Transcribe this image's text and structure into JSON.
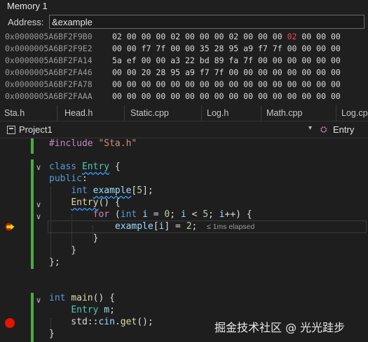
{
  "memory": {
    "title": "Memory 1",
    "address_label": "Address:",
    "address_value": "&example",
    "rows": [
      {
        "addr": "0x0000005A6BF2F9B0",
        "bytes": [
          "02",
          "00",
          "00",
          "00",
          "02",
          "00",
          "00",
          "00",
          "02",
          "00",
          "00",
          "00",
          "02",
          "00",
          "00",
          "00"
        ],
        "changed": [
          12
        ]
      },
      {
        "addr": "0x0000005A6BF2F9E2",
        "bytes": [
          "00",
          "00",
          "f7",
          "7f",
          "00",
          "00",
          "35",
          "28",
          "95",
          "a9",
          "f7",
          "7f",
          "00",
          "00",
          "00",
          "00"
        ],
        "changed": []
      },
      {
        "addr": "0x0000005A6BF2FA14",
        "bytes": [
          "5a",
          "ef",
          "00",
          "00",
          "a3",
          "22",
          "bd",
          "89",
          "fa",
          "7f",
          "00",
          "00",
          "00",
          "00",
          "00",
          "00"
        ],
        "changed": []
      },
      {
        "addr": "0x0000005A6BF2FA46",
        "bytes": [
          "00",
          "00",
          "20",
          "28",
          "95",
          "a9",
          "f7",
          "7f",
          "00",
          "00",
          "00",
          "00",
          "00",
          "00",
          "00",
          "00"
        ],
        "changed": []
      },
      {
        "addr": "0x0000005A6BF2FA78",
        "bytes": [
          "00",
          "00",
          "00",
          "00",
          "00",
          "00",
          "00",
          "00",
          "00",
          "00",
          "00",
          "00",
          "00",
          "00",
          "00",
          "00"
        ],
        "changed": []
      },
      {
        "addr": "0x0000005A6BF2FAAA",
        "bytes": [
          "00",
          "00",
          "00",
          "00",
          "00",
          "00",
          "00",
          "00",
          "00",
          "00",
          "00",
          "00",
          "00",
          "00",
          "00",
          "00"
        ],
        "changed": []
      }
    ]
  },
  "tabs": [
    "Sta.h",
    "Head.h",
    "Static.cpp",
    "Log.h",
    "Math.cpp",
    "Log.cpp"
  ],
  "navbar": {
    "project": "Project1",
    "scope": "Entry"
  },
  "editor": {
    "elapsed": "≤ 1ms elapsed",
    "watermark": "掘金技术社区 @ 光光跬步"
  },
  "colors": {
    "accent_green": "#4ea746",
    "breakpoint": "#e51400",
    "changed_byte": "#f14c4c"
  }
}
